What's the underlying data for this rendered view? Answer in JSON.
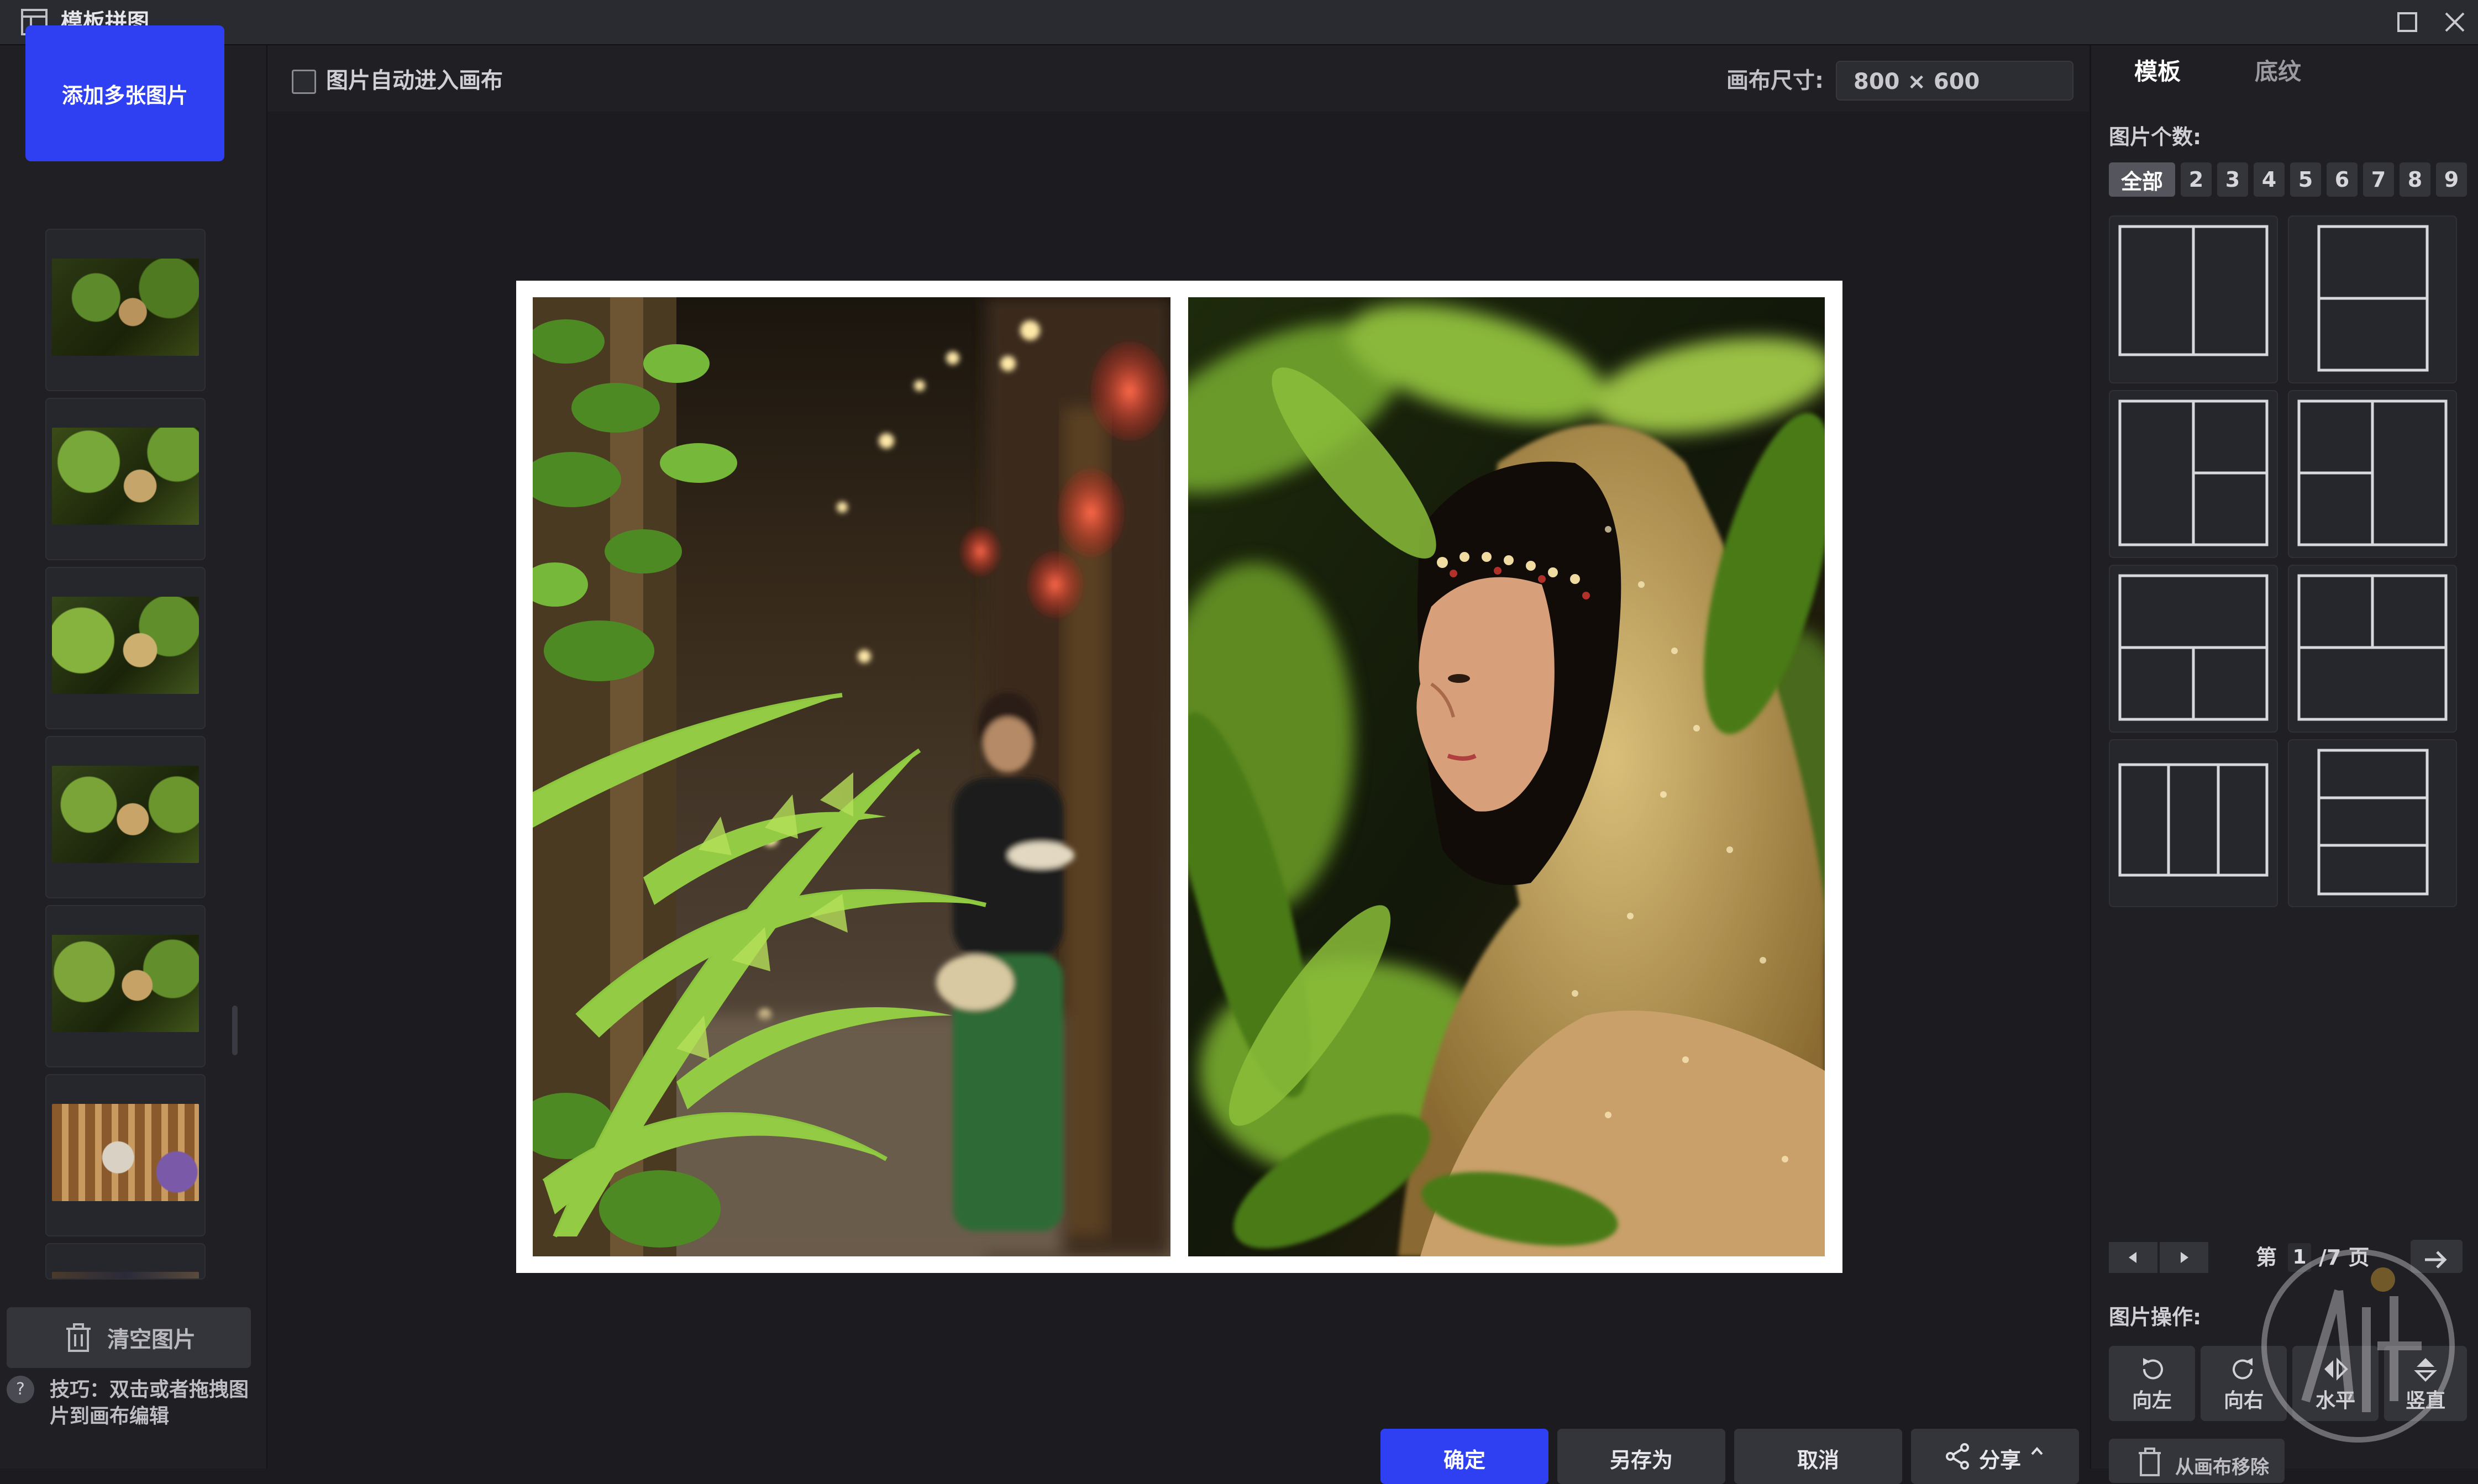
{
  "app": {
    "title": "模板拼图"
  },
  "left": {
    "add_button": "添加多张图片",
    "clear_button": "清空图片",
    "tip_icon": "?",
    "tip": "技巧：双击或者拖拽图片到画布编辑"
  },
  "toolbar": {
    "auto_canvas_label": "图片自动进入画布",
    "auto_canvas_checked": false,
    "canvas_size_label": "画布尺寸:",
    "canvas_size_value": "800 × 600"
  },
  "bottom": {
    "confirm": "确定",
    "save_as": "另存为",
    "cancel": "取消",
    "share": "分享"
  },
  "right": {
    "tabs": [
      "模板",
      "底纹"
    ],
    "active_tab": "模板",
    "count_label": "图片个数:",
    "counts": [
      "全部",
      "2",
      "3",
      "4",
      "5",
      "6",
      "7",
      "8",
      "9"
    ],
    "active_count": "全部",
    "pager": {
      "prefix": "第",
      "current": "1",
      "suffix": "/7 页"
    },
    "ops_label": "图片操作:",
    "ops": [
      "向左",
      "向右",
      "水平",
      "竖直"
    ],
    "remove_button": "从画布移除"
  },
  "icons": {
    "app": "layout-icon",
    "maximize": "maximize-icon",
    "close": "close-icon",
    "clear": "trash-icon",
    "share": "share-icon",
    "rotate_left": "rotate-left-icon",
    "rotate_right": "rotate-right-icon",
    "flip_h": "flip-horizontal-icon",
    "flip_v": "flip-vertical-icon"
  },
  "colors": {
    "accent": "#2f40f2",
    "selection": "#3d7bff",
    "background": "#1b1b20"
  }
}
